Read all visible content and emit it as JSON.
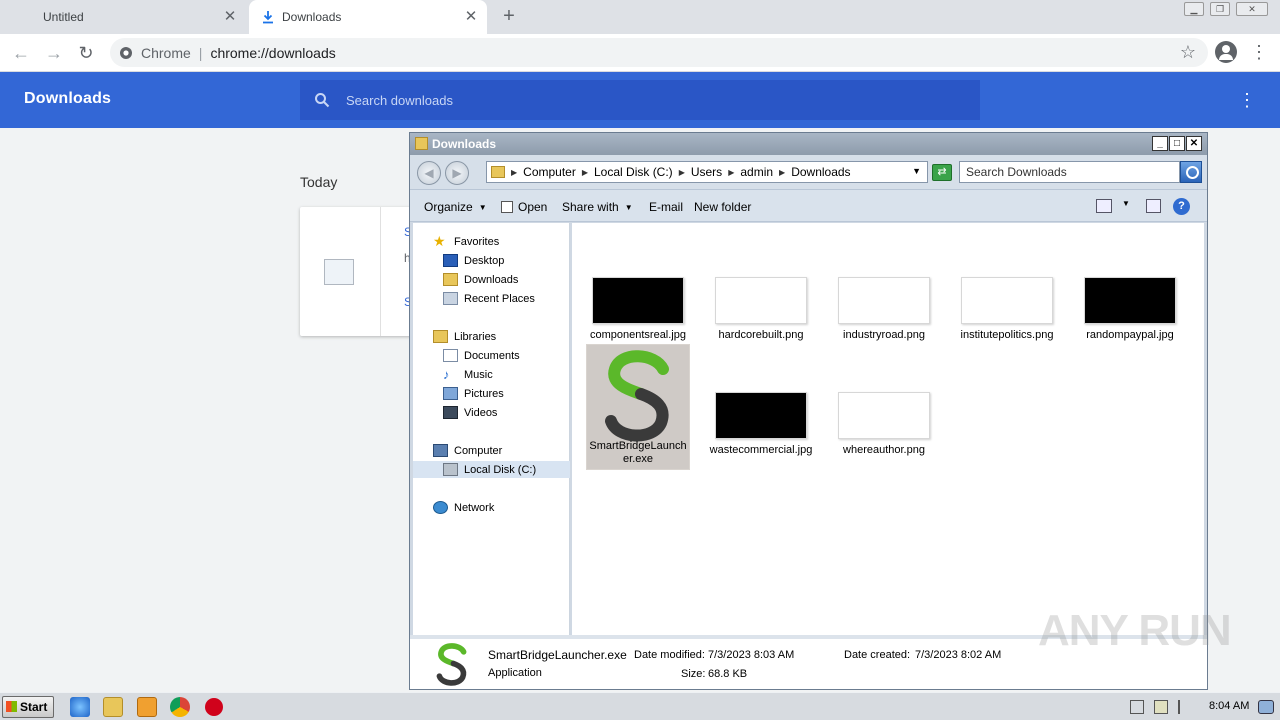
{
  "browser": {
    "tabs": [
      {
        "label": "Untitled",
        "active": false
      },
      {
        "label": "Downloads",
        "active": true
      }
    ],
    "omnibox": {
      "scheme_label": "Chrome",
      "url": "chrome://downloads"
    }
  },
  "downloads_page": {
    "title": "Downloads",
    "search_placeholder": "Search downloads",
    "section_label": "Today",
    "accent_color": "#3367d6"
  },
  "explorer": {
    "title": "Downloads",
    "breadcrumb": [
      "Computer",
      "Local Disk (C:)",
      "Users",
      "admin",
      "Downloads"
    ],
    "search_placeholder": "Search Downloads",
    "commands": {
      "organize": "Organize",
      "open": "Open",
      "share_with": "Share with",
      "email": "E-mail",
      "new_folder": "New folder"
    },
    "nav": {
      "favorites": "Favorites",
      "desktop": "Desktop",
      "downloads": "Downloads",
      "recent_places": "Recent Places",
      "libraries": "Libraries",
      "documents": "Documents",
      "music": "Music",
      "pictures": "Pictures",
      "videos": "Videos",
      "computer": "Computer",
      "local_disk": "Local Disk (C:)",
      "network": "Network"
    },
    "files": [
      {
        "name": "componentsreal.jpg",
        "thumb": "dark"
      },
      {
        "name": "hardcorebuilt.png",
        "thumb": "light"
      },
      {
        "name": "industryroad.png",
        "thumb": "light"
      },
      {
        "name": "institutepolitics.png",
        "thumb": "light"
      },
      {
        "name": "randompaypal.jpg",
        "thumb": "dark"
      },
      {
        "name": "SmartBridgeLauncher.exe",
        "thumb": "logo",
        "selected": true
      },
      {
        "name": "wastecommercial.jpg",
        "thumb": "dark"
      },
      {
        "name": "whereauthor.png",
        "thumb": "light"
      }
    ],
    "details": {
      "name": "SmartBridgeLauncher.exe",
      "type": "Application",
      "date_modified_label": "Date modified:",
      "date_modified": "7/3/2023 8:03 AM",
      "date_created_label": "Date created:",
      "date_created": "7/3/2023 8:02 AM",
      "size_label": "Size:",
      "size": "68.8 KB"
    }
  },
  "taskbar": {
    "start_label": "Start",
    "clock": "8:04 AM"
  },
  "watermark": "ANY RUN"
}
